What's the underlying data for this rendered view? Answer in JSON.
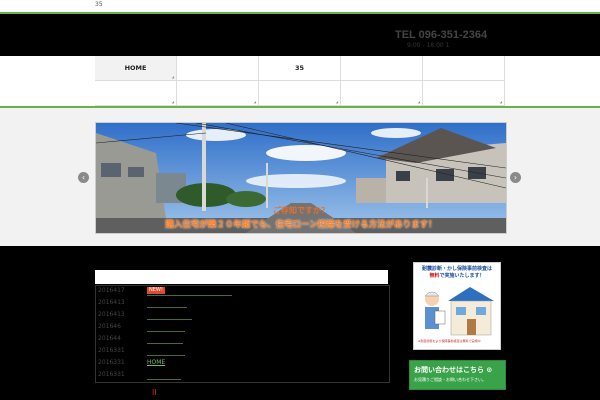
{
  "topbar": {
    "text": "35"
  },
  "header": {
    "tel": "TEL 096-351-2364",
    "hours": "9:00 - 18:00 1"
  },
  "nav": {
    "items": [
      {
        "label": "HOME"
      },
      {
        "label": ""
      },
      {
        "label": "35"
      },
      {
        "label": ""
      },
      {
        "label": ""
      },
      {
        "label": ""
      },
      {
        "label": ""
      },
      {
        "label": ""
      },
      {
        "label": ""
      },
      {
        "label": ""
      }
    ]
  },
  "slider": {
    "caption_line1": "ご存知ですか？",
    "caption_line2": "購入住宅が築２０年超でも、住宅ローン控除を受ける方法があります！",
    "prev_icon": "chevron-left-icon",
    "next_icon": "chevron-right-icon"
  },
  "news": {
    "items": [
      {
        "date": "2016417",
        "title": "",
        "badge": "NEW!"
      },
      {
        "date": "2016413",
        "title": "",
        "badge": ""
      },
      {
        "date": "2016413",
        "title": "",
        "badge": ""
      },
      {
        "date": "201646",
        "title": "",
        "badge": ""
      },
      {
        "date": "201644",
        "title": "",
        "badge": ""
      },
      {
        "date": "2016331",
        "title": "",
        "badge": ""
      },
      {
        "date": "2016331",
        "title": "HOME",
        "badge": ""
      },
      {
        "date": "2016331",
        "title": "",
        "badge": ""
      }
    ],
    "pagination": "ll"
  },
  "sidebar": {
    "banner1_line1": "耐震診断・かし保険事前検査は",
    "banner1_highlight": "無料",
    "banner1_line2": "で実施いたします！",
    "banner1_note": "※耐震診断および保険事前検査は無料で実施中",
    "banner2_main": "お問い合わせはこちら ⊙",
    "banner2_sub": "お見積りご相談・お問い合わせ下さい。"
  },
  "colors": {
    "accent_green": "#6ab04c",
    "caption_orange": "#ff7a1a",
    "badge_red": "#e04b2b"
  }
}
